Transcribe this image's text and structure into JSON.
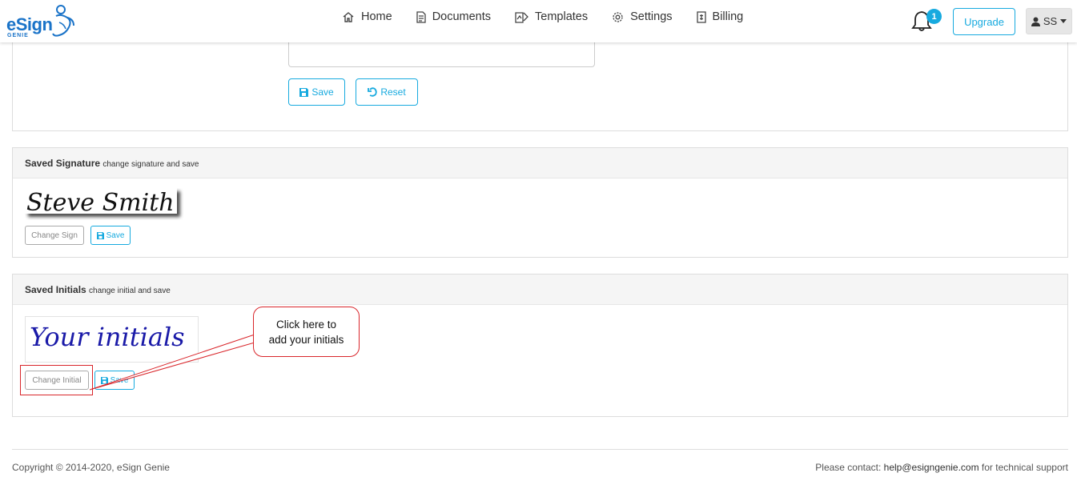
{
  "brand": {
    "name": "eSign",
    "sub": "GENIE"
  },
  "nav": [
    {
      "label": "Home",
      "icon": "home-icon"
    },
    {
      "label": "Documents",
      "icon": "document-icon"
    },
    {
      "label": "Templates",
      "icon": "template-icon"
    },
    {
      "label": "Settings",
      "icon": "gear-icon"
    },
    {
      "label": "Billing",
      "icon": "billing-icon"
    }
  ],
  "header": {
    "notification_count": "1",
    "upgrade_label": "Upgrade",
    "user_initials": "SS"
  },
  "top_panel": {
    "save_label": "Save",
    "reset_label": "Reset"
  },
  "signature_panel": {
    "title": "Saved Signature",
    "subtitle": "change signature and save",
    "signature_text": "Steve Smith",
    "change_label": "Change Sign",
    "save_label": "Save"
  },
  "initials_panel": {
    "title": "Saved Initials",
    "subtitle": "change initial and save",
    "initials_text": "Your initials",
    "change_label": "Change Initial",
    "save_label": "Save"
  },
  "callout": {
    "line1": "Click here to",
    "line2": "add your initials"
  },
  "footer": {
    "copyright": "Copyright © 2014-2020, eSign Genie",
    "contact_prefix": "Please contact: ",
    "contact_email": "help@esigngenie.com",
    "contact_suffix": " for technical support"
  },
  "colors": {
    "accent": "#17aadf",
    "brand": "#1a73c8",
    "callout": "#d9262b"
  }
}
